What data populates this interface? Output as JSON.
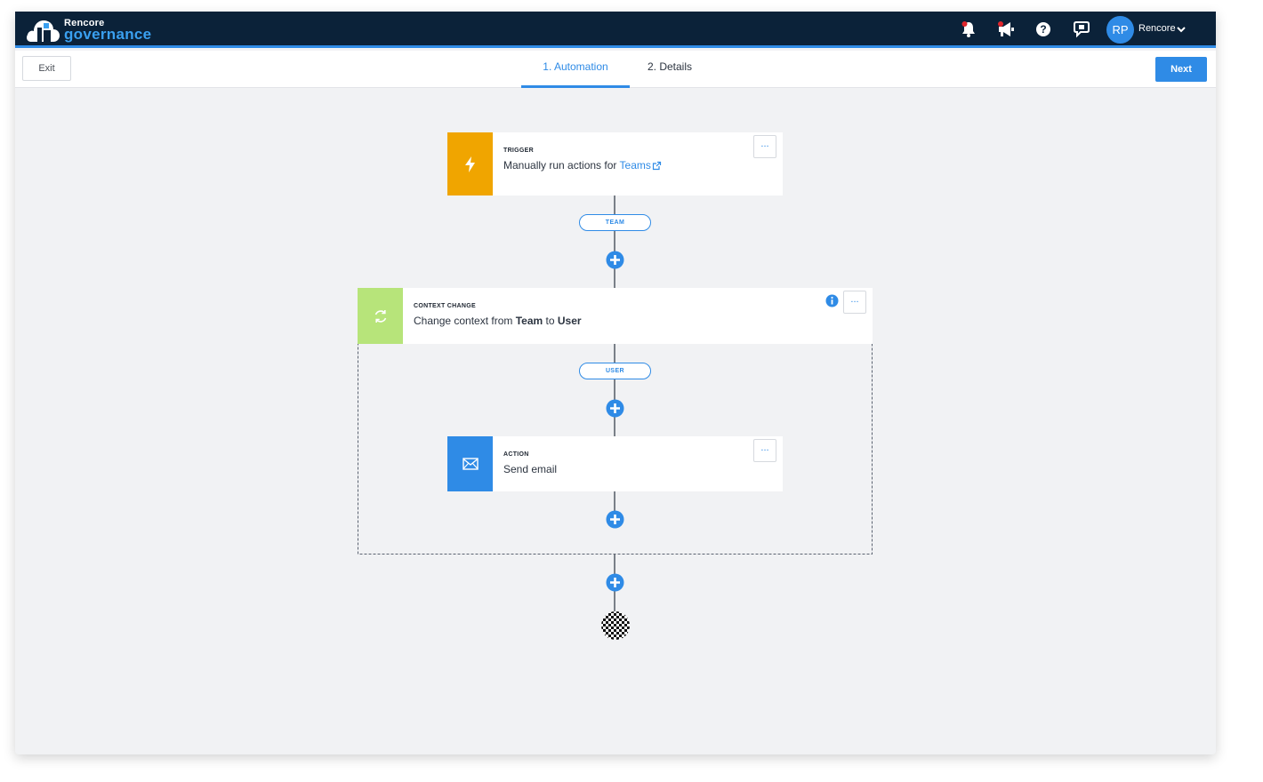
{
  "header": {
    "logo_small": "Rencore",
    "logo_big": "governance",
    "icons": [
      "bell-icon",
      "megaphone-icon",
      "help-icon",
      "feedback-icon"
    ],
    "user_initials": "RP",
    "user_name": "Rencore",
    "accent": "#2f8be6",
    "background": "#0b2239"
  },
  "toolbar": {
    "exit_label": "Exit",
    "tabs": [
      {
        "label": "1. Automation",
        "active": true
      },
      {
        "label": "2. Details",
        "active": false
      }
    ],
    "next_label": "Next"
  },
  "flow": {
    "trigger": {
      "tag": "TRIGGER",
      "text": "Manually run actions for ",
      "link": "Teams",
      "color": "#f0a500",
      "icon": "lightning-icon",
      "more": "..."
    },
    "connector_1": "TEAM",
    "context_change": {
      "tag": "CONTEXT CHANGE",
      "text_prefix": "Change context from ",
      "from": "Team",
      "text_mid": " to ",
      "to": "User",
      "color": "#b7e47a",
      "icon": "refresh-icon",
      "info_icon": "info-icon",
      "more": "..."
    },
    "connector_2": "USER",
    "action": {
      "tag": "ACTION",
      "text": "Send email",
      "color": "#2f8be6",
      "icon": "mail-icon",
      "more": "..."
    },
    "end_icon": "finish-flag-icon"
  }
}
